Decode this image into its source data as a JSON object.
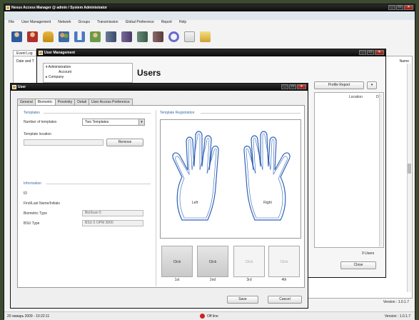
{
  "main": {
    "title": "Nexus Access Manager @ admin / System Administrator",
    "menu": [
      "File",
      "User Management",
      "Network",
      "Groups",
      "Transmission",
      "Global Preference",
      "Report",
      "Help"
    ],
    "tab": "Event Log",
    "column": "Date and T",
    "right_column": "Name",
    "version": "Version : 1.0.1.7",
    "status_datetime": "20 январь 2009 - 10:22:11",
    "status_state": "Off line"
  },
  "um": {
    "title": "User Management",
    "tree": [
      "Administration",
      "Account",
      "Company"
    ],
    "heading": "Users",
    "profile_report": "Profile Report",
    "columns": [
      "Location",
      "Dv"
    ],
    "count": "0 Users",
    "close": "Close"
  },
  "ud": {
    "title": "User",
    "tabs": [
      "General",
      "Biometric",
      "Proximity",
      "Detail",
      "User Access Preference"
    ],
    "templates_legend": "Templates",
    "num_templates_label": "Number of templates",
    "num_templates_value": "Two Templates",
    "template_location_label": "Template location",
    "remove": "Remove",
    "information_legend": "Information",
    "id_label": "ID",
    "name_label": "First/Last Name/Initials",
    "biometric_type_label": "Biometric Type",
    "biometric_type_value": "BioScan 5",
    "bsu_type_label": "BSU Type",
    "bsu_type_value": "BSU 5 OPM 3000",
    "registration_legend": "Template Registration",
    "left": "Left",
    "right": "Right",
    "click_buttons": [
      {
        "label": "Click",
        "finger": "1st"
      },
      {
        "label": "Click",
        "finger": "2nd"
      },
      {
        "label": "Click",
        "finger": "3rd"
      },
      {
        "label": "Click",
        "finger": "4th"
      }
    ],
    "save": "Save",
    "cancel": "Cancel"
  }
}
